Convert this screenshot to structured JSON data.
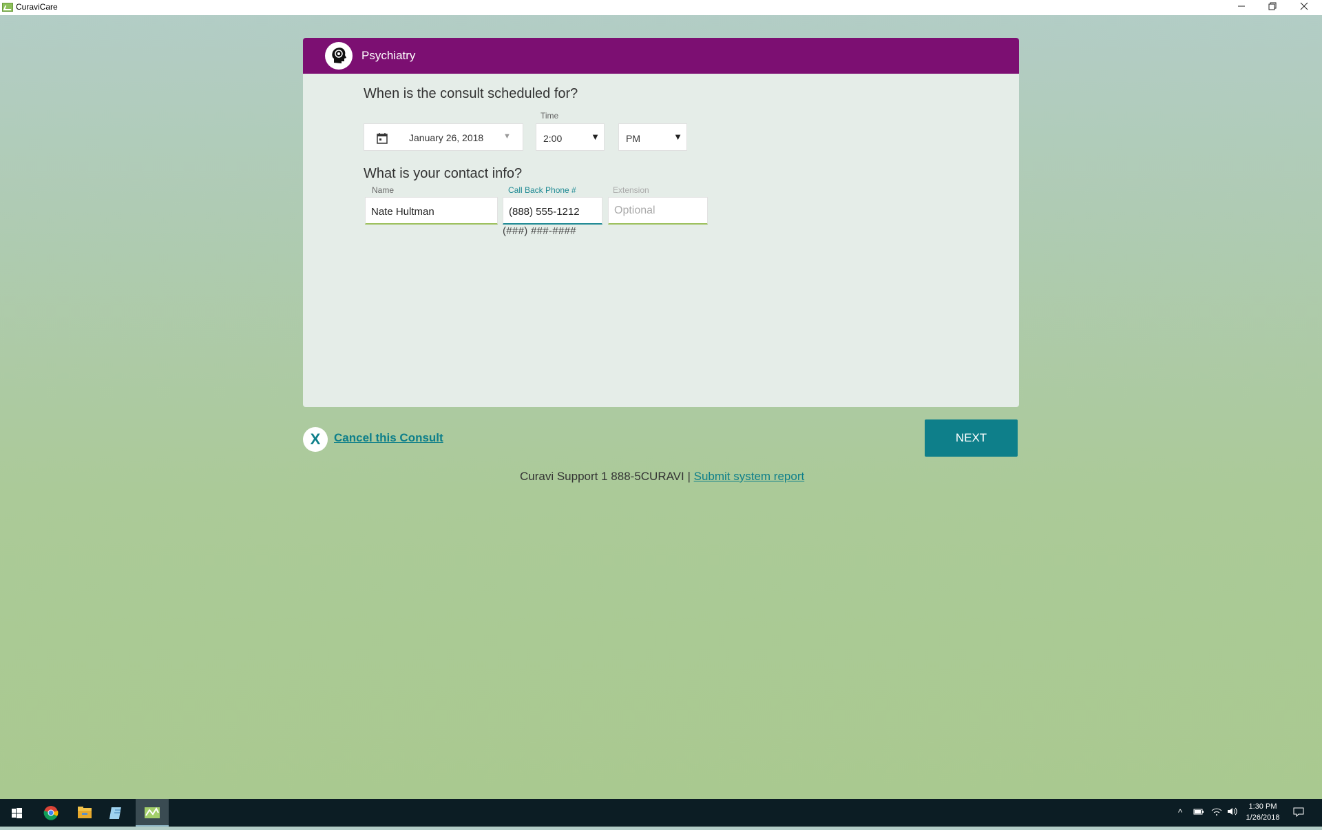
{
  "window": {
    "title": "CuraviCare"
  },
  "header": {
    "specialty": "Psychiatry"
  },
  "schedule": {
    "question": "When is the consult scheduled for?",
    "date": "January 26, 2018",
    "time_label": "Time",
    "time": "2:00",
    "ampm": "PM"
  },
  "contact": {
    "question": "What is your contact info?",
    "name_label": "Name",
    "name_value": "Nate Hultman",
    "phone_label": "Call Back Phone #",
    "phone_value": "(888) 555-1212",
    "phone_hint": "(###) ###-####",
    "ext_label": "Extension",
    "ext_placeholder": "Optional"
  },
  "actions": {
    "cancel_icon": "X",
    "cancel_label": "Cancel this Consult",
    "next_label": "NEXT"
  },
  "footer": {
    "support_text": "Curavi Support 1 888-5CURAVI | ",
    "report_link": "Submit system report"
  },
  "taskbar": {
    "time": "1:30 PM",
    "date": "1/26/2018"
  },
  "colors": {
    "header_purple": "#7c0f72",
    "accent_teal": "#0e7f8a",
    "field_green": "#9cc05c"
  }
}
